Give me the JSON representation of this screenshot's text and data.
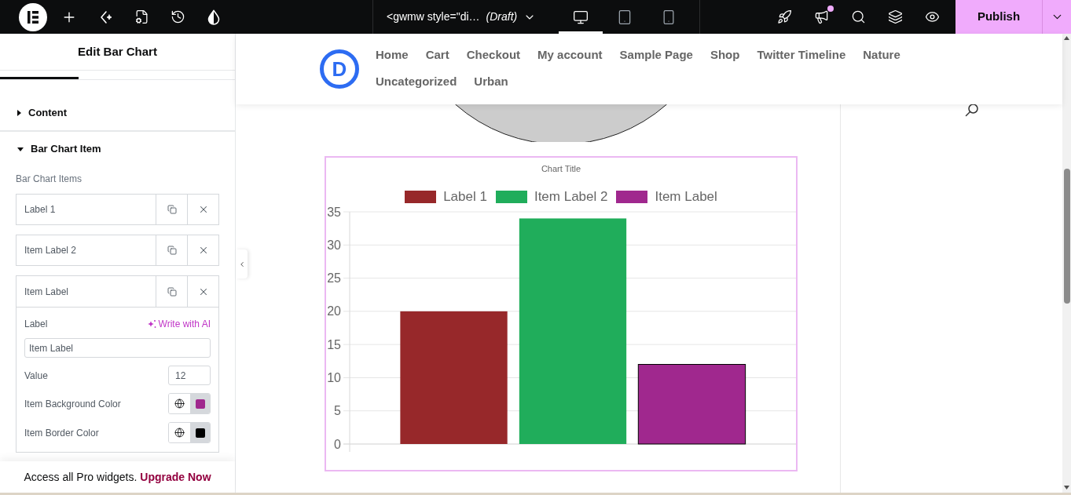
{
  "top_bar": {
    "title": "<gwmw style=\"di…",
    "status": "(Draft)",
    "devices": [
      {
        "selected": true
      },
      {
        "selected": false
      },
      {
        "selected": false
      }
    ],
    "whats_new": {
      "unread": true
    },
    "publish": "Publish"
  },
  "editor_panel": {
    "title": "Edit Bar Chart",
    "tabs": [
      {
        "selected": true
      },
      {
        "selected": false
      },
      {
        "selected": false
      }
    ],
    "sections": [
      {
        "title": "Content",
        "expanded": false
      },
      {
        "title": "Bar Chart Item",
        "expanded": true,
        "repeater": {
          "label": "Bar Chart Items",
          "items": [
            {
              "label": "Label 1",
              "expanded": false
            },
            {
              "label": "Item Label 2",
              "expanded": false
            },
            {
              "label": "Item Label",
              "expanded": true,
              "fields": [
                {
                  "kind": "text",
                  "label": "Label",
                  "action": "Write with AI",
                  "value": "Item Label"
                },
                {
                  "kind": "number",
                  "label": "Value",
                  "value": "12"
                },
                {
                  "kind": "color",
                  "label": "Item Background Color",
                  "color": "#a0288e"
                },
                {
                  "kind": "color",
                  "label": "Item Border Color",
                  "color": "#000000"
                }
              ]
            }
          ]
        }
      }
    ],
    "promo": {
      "text": "Access all Pro widgets.",
      "link": "Upgrade Now"
    }
  },
  "preview": {
    "logo": "D",
    "nav": [
      "Home",
      "Cart",
      "Checkout",
      "My account",
      "Sample Page",
      "Shop",
      "Twitter Timeline",
      "Nature",
      "Uncategorized",
      "Urban"
    ],
    "chart_data": {
      "type": "bar",
      "title": "Chart Title",
      "legend": "top",
      "grid": true,
      "series": [
        {
          "name": "Label 1",
          "color": "#97282a",
          "values": [
            20
          ]
        },
        {
          "name": "Item Label 2",
          "color": "#20ad5b",
          "values": [
            34
          ]
        },
        {
          "name": "Item Label",
          "color": "#a0288e",
          "values": [
            12
          ]
        }
      ],
      "ylim": [
        0,
        35
      ],
      "yticks": [
        0,
        5,
        10,
        15,
        20,
        25,
        30,
        35
      ]
    }
  }
}
